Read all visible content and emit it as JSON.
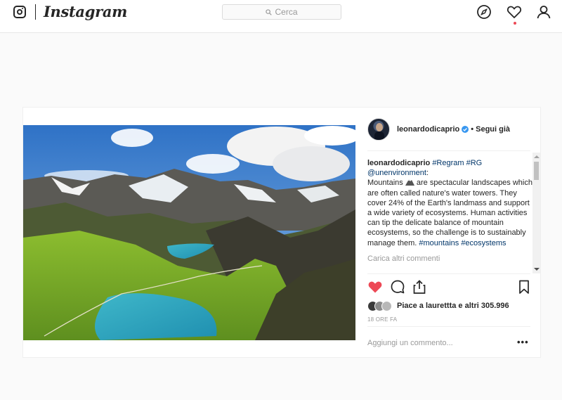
{
  "topbar": {
    "brand": "Instagram",
    "search_placeholder": "Cerca",
    "icons": [
      "instagram-glyph-icon",
      "search-icon",
      "compass-icon",
      "heart-icon",
      "user-icon"
    ]
  },
  "post": {
    "username": "leonardodicaprio",
    "follow_separator": "•",
    "follow_label": "Segui già",
    "caption": {
      "username": "leonardodicaprio",
      "tags_inline": "#Regram #RG",
      "mention": "@unenvironment",
      "mention_suffix": ":",
      "text_before_emoji": "Mountains",
      "text_after_emoji": "are spectacular landscapes which are often called nature's water towers. They cover 24% of the Earth's landmass and support a wide variety of ecosystems. Human activities can tip the delicate balance of mountain ecosystems, so the challenge is to sustainably manage them.",
      "trailing_tags": "#mountains #ecosystems"
    },
    "load_more_label": "Carica altri commenti",
    "likes_text": "Piace a laurettta e altri 305.996",
    "time_label": "18 ORE FA",
    "add_comment_placeholder": "Aggiungi un commento...",
    "more_label": "•••",
    "liked": true,
    "colors": {
      "like": "#ed4956",
      "link": "#003569",
      "muted": "#999999",
      "verified": "#3897f0"
    }
  }
}
